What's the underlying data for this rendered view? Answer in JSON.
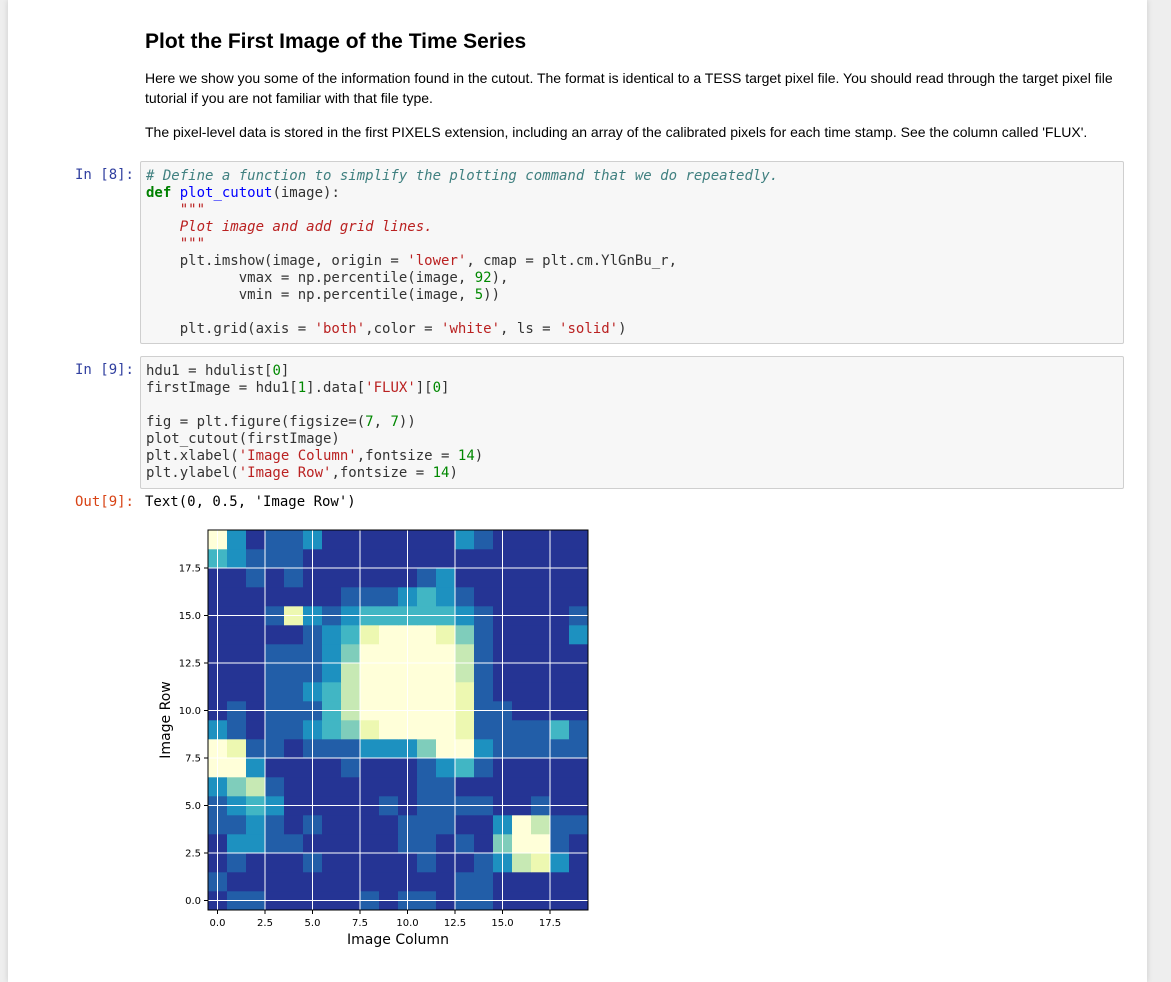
{
  "markdown": {
    "heading": "Plot the First Image of the Time Series",
    "para1": "Here we show you some of the information found in the cutout. The format is identical to a TESS target pixel file. You should read through the target pixel file tutorial if you are not familiar with that file type.",
    "para2": "The pixel-level data is stored in the first PIXELS extension, including an array of the calibrated pixels for each time stamp. See the column called 'FLUX'."
  },
  "cells": [
    {
      "prompt": "In [8]:",
      "lines": [
        [
          {
            "t": "# Define a function to simplify the plotting command that we do repeatedly.",
            "c": "comment"
          }
        ],
        [
          {
            "t": "def",
            "c": "keyword"
          },
          {
            "t": " "
          },
          {
            "t": "plot_cutout",
            "c": "def"
          },
          {
            "t": "(image):"
          }
        ],
        [
          {
            "t": "    \"\"\"",
            "c": "doc"
          }
        ],
        [
          {
            "t": "    Plot image and add grid lines.",
            "c": "doc"
          }
        ],
        [
          {
            "t": "    \"\"\"",
            "c": "doc"
          }
        ],
        [
          {
            "t": "    plt.imshow(image, origin = "
          },
          {
            "t": "'lower'",
            "c": "string"
          },
          {
            "t": ", cmap = plt.cm.YlGnBu_r,"
          }
        ],
        [
          {
            "t": "           vmax = np.percentile(image, "
          },
          {
            "t": "92",
            "c": "number"
          },
          {
            "t": "),"
          }
        ],
        [
          {
            "t": "           vmin = np.percentile(image, "
          },
          {
            "t": "5",
            "c": "number"
          },
          {
            "t": "))"
          }
        ],
        [
          {
            "t": ""
          }
        ],
        [
          {
            "t": "    plt.grid(axis = "
          },
          {
            "t": "'both'",
            "c": "string"
          },
          {
            "t": ",color = "
          },
          {
            "t": "'white'",
            "c": "string"
          },
          {
            "t": ", ls = "
          },
          {
            "t": "'solid'",
            "c": "string"
          },
          {
            "t": ")"
          }
        ]
      ]
    },
    {
      "prompt": "In [9]:",
      "lines": [
        [
          {
            "t": "hdu1 = hdulist["
          },
          {
            "t": "0",
            "c": "number"
          },
          {
            "t": "]"
          }
        ],
        [
          {
            "t": "firstImage = hdu1["
          },
          {
            "t": "1",
            "c": "number"
          },
          {
            "t": "].data["
          },
          {
            "t": "'FLUX'",
            "c": "string"
          },
          {
            "t": "]["
          },
          {
            "t": "0",
            "c": "number"
          },
          {
            "t": "]"
          }
        ],
        [
          {
            "t": ""
          }
        ],
        [
          {
            "t": "fig = plt.figure(figsize=("
          },
          {
            "t": "7",
            "c": "number"
          },
          {
            "t": ", "
          },
          {
            "t": "7",
            "c": "number"
          },
          {
            "t": "))"
          }
        ],
        [
          {
            "t": "plot_cutout(firstImage)"
          }
        ],
        [
          {
            "t": "plt.xlabel("
          },
          {
            "t": "'Image Column'",
            "c": "string"
          },
          {
            "t": ",fontsize = "
          },
          {
            "t": "14",
            "c": "number"
          },
          {
            "t": ")"
          }
        ],
        [
          {
            "t": "plt.ylabel("
          },
          {
            "t": "'Image Row'",
            "c": "string"
          },
          {
            "t": ",fontsize = "
          },
          {
            "t": "14",
            "c": "number"
          },
          {
            "t": ")"
          }
        ]
      ]
    }
  ],
  "output": {
    "prompt": "Out[9]:",
    "text": "Text(0, 0.5, 'Image Row')"
  },
  "chart_data": {
    "type": "heatmap",
    "title": "",
    "xlabel": "Image Column",
    "ylabel": "Image Row",
    "xticks": [
      "0.0",
      "2.5",
      "5.0",
      "7.5",
      "10.0",
      "12.5",
      "15.0",
      "17.5"
    ],
    "yticks": [
      "0.0",
      "2.5",
      "5.0",
      "7.5",
      "10.0",
      "12.5",
      "15.0",
      "17.5"
    ],
    "xlim": [
      -0.5,
      19.5
    ],
    "ylim": [
      -0.5,
      19.5
    ],
    "colormap": "YlGnBu_r",
    "grid": true,
    "grid_color": "#ffffff",
    "colorscale": [
      "#081d58",
      "#253494",
      "#225ea8",
      "#1d91c0",
      "#41b6c4",
      "#7fcdbb",
      "#c7e9b4",
      "#edf8b1",
      "#ffffd9"
    ],
    "z": [
      [
        1,
        2,
        2,
        1,
        1,
        1,
        1,
        1,
        2,
        1,
        2,
        2,
        1,
        2,
        2,
        1,
        1,
        1,
        1,
        1
      ],
      [
        2,
        1,
        1,
        1,
        1,
        1,
        1,
        1,
        1,
        1,
        1,
        1,
        1,
        2,
        2,
        1,
        1,
        1,
        1,
        1
      ],
      [
        1,
        2,
        1,
        1,
        1,
        2,
        1,
        1,
        1,
        1,
        1,
        2,
        1,
        1,
        2,
        3,
        6,
        7,
        3,
        1
      ],
      [
        1,
        3,
        3,
        2,
        2,
        1,
        1,
        1,
        1,
        1,
        2,
        2,
        1,
        2,
        1,
        5,
        8,
        8,
        2,
        1
      ],
      [
        2,
        2,
        3,
        2,
        1,
        2,
        1,
        1,
        1,
        1,
        2,
        2,
        2,
        1,
        1,
        3,
        8,
        6,
        2,
        2
      ],
      [
        2,
        3,
        4,
        3,
        1,
        1,
        1,
        1,
        1,
        2,
        1,
        2,
        2,
        2,
        2,
        1,
        1,
        2,
        1,
        1
      ],
      [
        3,
        5,
        6,
        2,
        1,
        1,
        1,
        1,
        1,
        1,
        1,
        2,
        2,
        1,
        1,
        1,
        1,
        1,
        1,
        1
      ],
      [
        8,
        8,
        3,
        1,
        1,
        1,
        1,
        2,
        1,
        1,
        1,
        2,
        3,
        4,
        2,
        1,
        1,
        1,
        1,
        1
      ],
      [
        8,
        7,
        2,
        2,
        1,
        2,
        2,
        2,
        3,
        3,
        3,
        5,
        8,
        8,
        3,
        2,
        2,
        2,
        2,
        2
      ],
      [
        3,
        2,
        1,
        2,
        2,
        3,
        4,
        5,
        7,
        8,
        8,
        8,
        8,
        7,
        2,
        2,
        2,
        2,
        4,
        2
      ],
      [
        1,
        2,
        1,
        2,
        2,
        2,
        4,
        6,
        8,
        8,
        8,
        8,
        8,
        7,
        2,
        2,
        1,
        1,
        1,
        1
      ],
      [
        1,
        1,
        1,
        2,
        2,
        3,
        4,
        6,
        8,
        8,
        8,
        8,
        8,
        7,
        2,
        1,
        1,
        1,
        1,
        1
      ],
      [
        1,
        1,
        1,
        2,
        2,
        2,
        3,
        6,
        8,
        8,
        8,
        8,
        8,
        6,
        2,
        1,
        1,
        1,
        1,
        1
      ],
      [
        1,
        1,
        1,
        2,
        2,
        2,
        3,
        5,
        8,
        8,
        8,
        8,
        8,
        6,
        2,
        1,
        1,
        1,
        1,
        1
      ],
      [
        1,
        1,
        1,
        1,
        1,
        2,
        3,
        4,
        7,
        8,
        8,
        8,
        7,
        5,
        2,
        1,
        1,
        1,
        1,
        3
      ],
      [
        1,
        1,
        1,
        2,
        7,
        3,
        2,
        3,
        4,
        4,
        4,
        4,
        4,
        3,
        2,
        1,
        1,
        1,
        1,
        2
      ],
      [
        1,
        1,
        1,
        1,
        1,
        1,
        1,
        2,
        2,
        2,
        3,
        4,
        3,
        2,
        1,
        1,
        1,
        1,
        1,
        1
      ],
      [
        1,
        1,
        2,
        1,
        2,
        1,
        1,
        1,
        1,
        1,
        1,
        2,
        3,
        1,
        1,
        1,
        1,
        1,
        1,
        1
      ],
      [
        4,
        3,
        2,
        2,
        2,
        1,
        1,
        1,
        1,
        1,
        1,
        1,
        1,
        1,
        1,
        1,
        1,
        1,
        1,
        1
      ],
      [
        8,
        3,
        1,
        2,
        2,
        3,
        1,
        1,
        1,
        1,
        1,
        1,
        1,
        3,
        2,
        1,
        1,
        1,
        1,
        1
      ]
    ]
  }
}
